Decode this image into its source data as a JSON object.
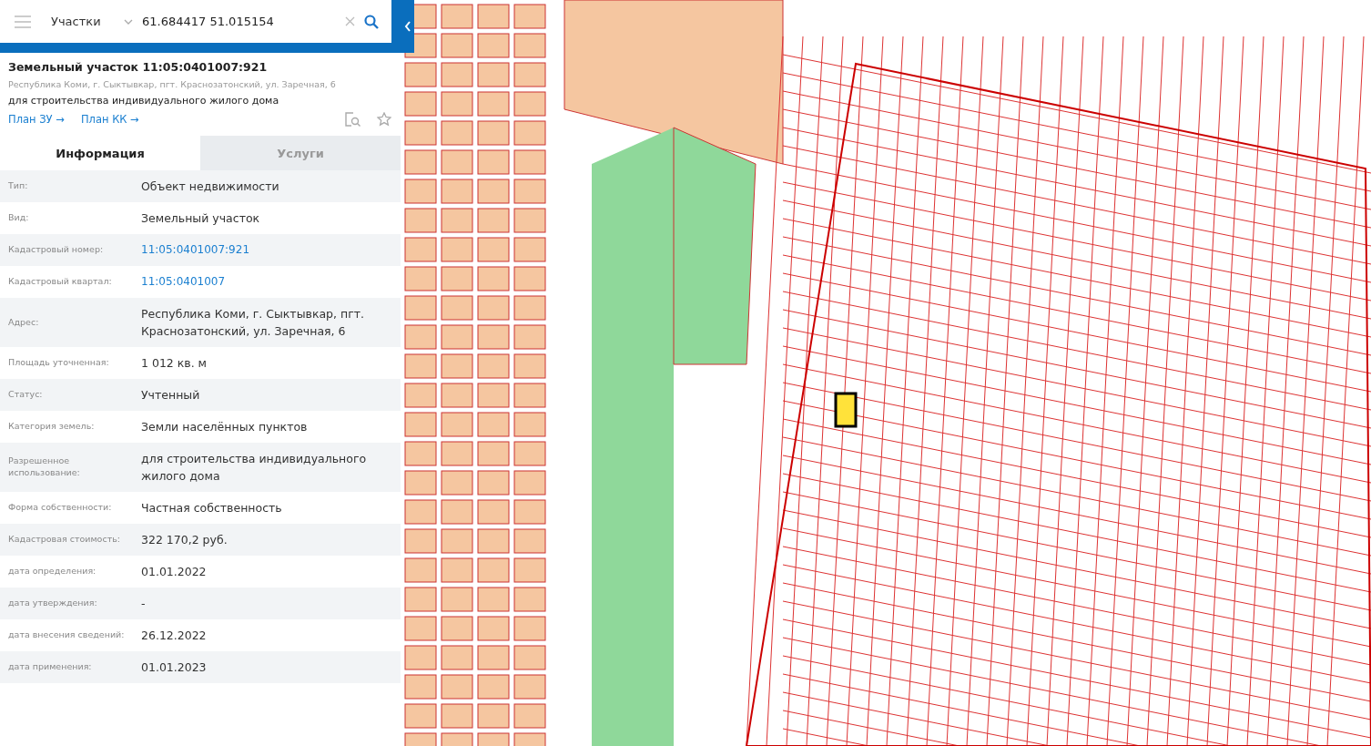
{
  "search": {
    "layer": "Участки",
    "value": "61.684417 51.015154"
  },
  "object": {
    "title": "Земельный участок 11:05:0401007:921",
    "address": "Республика Коми, г. Сыктывкар, пгт. Краснозатонский, ул. Заречная, 6",
    "purpose": "для строительства индивидуального жилого дома",
    "links": [
      "План ЗУ →",
      "План КК →"
    ]
  },
  "tabs": [
    {
      "label": "Информация",
      "selected": true
    },
    {
      "label": "Услуги",
      "selected": false
    }
  ],
  "rows": [
    {
      "label": "Тип:",
      "value": "Объект недвижимости",
      "kind": "text"
    },
    {
      "label": "Вид:",
      "value": "Земельный участок",
      "kind": "text"
    },
    {
      "label": "Кадастровый номер:",
      "value": "11:05:0401007:921",
      "kind": "link"
    },
    {
      "label": "Кадастровый квартал:",
      "value": "11:05:0401007",
      "kind": "link"
    },
    {
      "label": "Адрес:",
      "value": "Республика Коми, г. Сыктывкар, пгт. Краснозатонский, ул. Заречная, 6",
      "kind": "text"
    },
    {
      "label": "Площадь уточненная:",
      "value": "1 012 кв. м",
      "kind": "text"
    },
    {
      "label": "Статус:",
      "value": "Учтенный",
      "kind": "text"
    },
    {
      "label": "Категория земель:",
      "value": "Земли населённых пунктов",
      "kind": "text"
    },
    {
      "label": "Разрешенное использование:",
      "value": "для строительства индивидуального жилого дома",
      "kind": "text"
    },
    {
      "label": "Форма собственности:",
      "value": "Частная собственность",
      "kind": "text"
    },
    {
      "label": "Кадастровая стоимость:",
      "value": "322 170,2 руб.",
      "kind": "text"
    },
    {
      "label": "дата определения:",
      "value": "01.01.2022",
      "kind": "text"
    },
    {
      "label": "дата утверждения:",
      "value": "-",
      "kind": "text"
    },
    {
      "label": "дата внесения сведений:",
      "value": "26.12.2022",
      "kind": "text"
    },
    {
      "label": "дата применения:",
      "value": "01.01.2023",
      "kind": "text"
    }
  ]
}
